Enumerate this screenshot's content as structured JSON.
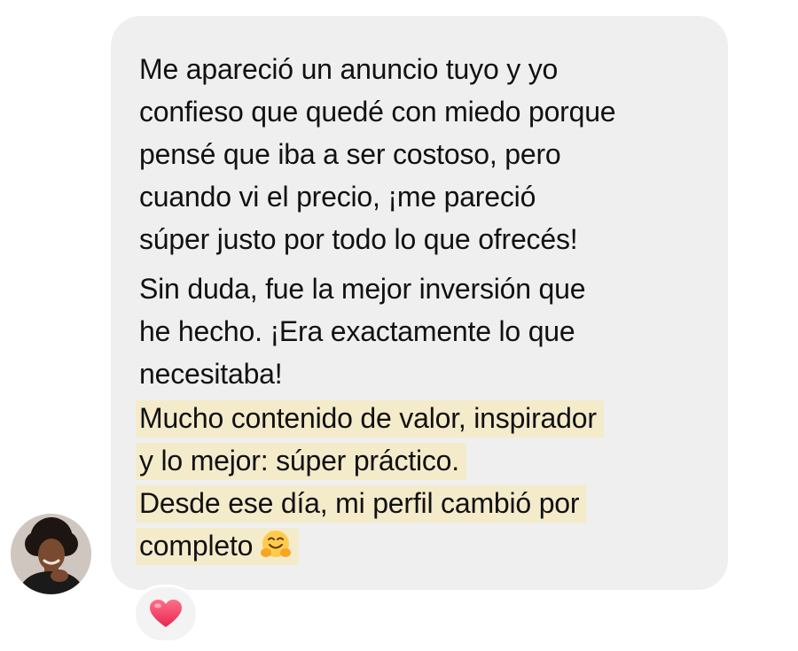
{
  "message": {
    "paragraph1": [
      "Me apareció un anuncio tuyo y yo",
      "confieso que quedé con miedo porque",
      "pensé que iba a ser costoso, pero",
      "cuando vi el precio, ¡me pareció",
      "súper justo por todo lo que ofrecés!"
    ],
    "paragraph2": [
      "Sin duda, fue la mejor inversión que",
      "he hecho. ¡Era exactamente lo que",
      "necesitaba!"
    ],
    "highlighted": [
      "Mucho contenido de valor, inspirador",
      "y lo mejor: súper práctico.",
      "Desde ese día, mi perfil cambió por",
      "completo"
    ],
    "trailing_emoji": "hugging-face-emoji",
    "highlight_color": "#f4ebcb",
    "bubble_color": "#efefef"
  },
  "sender": {
    "avatar": "avatar-photo"
  },
  "reaction": {
    "icon": "heart-icon",
    "color": "#f0466a"
  }
}
